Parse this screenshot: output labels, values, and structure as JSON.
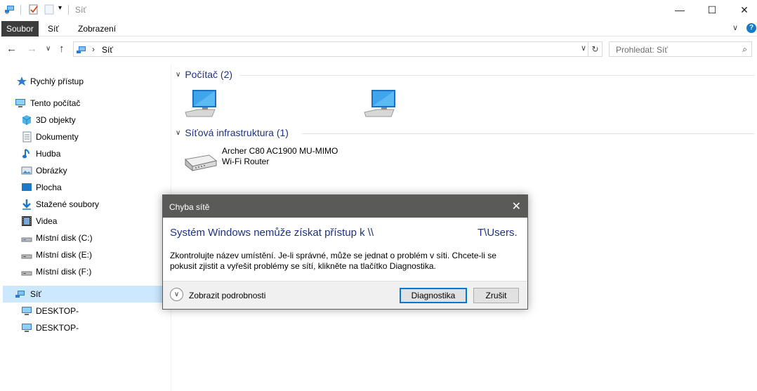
{
  "titlebar": {
    "title": "Síť",
    "icons": [
      "network-icon",
      "properties-icon",
      "new-folder-icon",
      "customize-dropdown-icon"
    ],
    "minimize": "—",
    "maximize": "☐",
    "close": "✕"
  },
  "ribbon": {
    "tabs": [
      {
        "label": "Soubor",
        "active": true
      },
      {
        "label": "Síť"
      },
      {
        "label": "Zobrazení"
      }
    ],
    "expand_glyph": "∨",
    "help_glyph": "?"
  },
  "addressbar": {
    "back": "←",
    "forward": "→",
    "recent": "∨",
    "up": "↑",
    "separator": "›",
    "crumb": "Síť",
    "dropdown": "∨",
    "refresh": "↻"
  },
  "search": {
    "placeholder": "Prohledat: Síť",
    "icon": "⌕"
  },
  "sidebar": {
    "items": [
      {
        "label": "Rychlý přístup",
        "icon": "star-icon"
      },
      {
        "label": "Tento počítač",
        "icon": "computer-icon"
      },
      {
        "label": "3D objekty",
        "icon": "3d-objects-icon"
      },
      {
        "label": "Dokumenty",
        "icon": "documents-icon"
      },
      {
        "label": "Hudba",
        "icon": "music-icon"
      },
      {
        "label": "Obrázky",
        "icon": "pictures-icon"
      },
      {
        "label": "Plocha",
        "icon": "desktop-icon"
      },
      {
        "label": "Stažené soubory",
        "icon": "downloads-icon"
      },
      {
        "label": "Videa",
        "icon": "videos-icon"
      },
      {
        "label": "Místní disk (C:)",
        "icon": "drive-icon"
      },
      {
        "label": "Místní disk (E:)",
        "icon": "drive-icon"
      },
      {
        "label": "Místní disk (F:)",
        "icon": "drive-icon"
      },
      {
        "label": "Síť",
        "icon": "network-icon",
        "selected": true
      },
      {
        "label": "DESKTOP-",
        "icon": "computer-icon"
      },
      {
        "label": "DESKTOP-",
        "icon": "computer-icon"
      }
    ]
  },
  "content": {
    "groups": [
      {
        "header": "Počítač (2)",
        "arrow": "∨"
      },
      {
        "header": "Síťová infrastruktura (1)",
        "arrow": "∨"
      }
    ],
    "router": {
      "name": "Archer C80 AC1900 MU-MIMO",
      "type": "Wi-Fi Router"
    }
  },
  "dialog": {
    "title": "Chyba sítě",
    "close": "✕",
    "heading_left": "Systém Windows nemůže získat přístup k \\\\",
    "heading_right": "T\\Users.",
    "body": "Zkontrolujte název umístění. Je-li správné, může se jednat o problém v síti. Chcete-li se pokusit zjistit a vyřešit problémy se sítí, klikněte na tlačítko Diagnostika.",
    "details_label": "Zobrazit podrobnosti",
    "details_glyph": "∨",
    "buttons": {
      "diagnose": "Diagnostika",
      "cancel": "Zrušit"
    }
  },
  "colors": {
    "heading_blue": "#1e3287",
    "selection": "#cce8ff",
    "dialog_title_bg": "#5a5a58",
    "primary_border": "#0078d7"
  }
}
